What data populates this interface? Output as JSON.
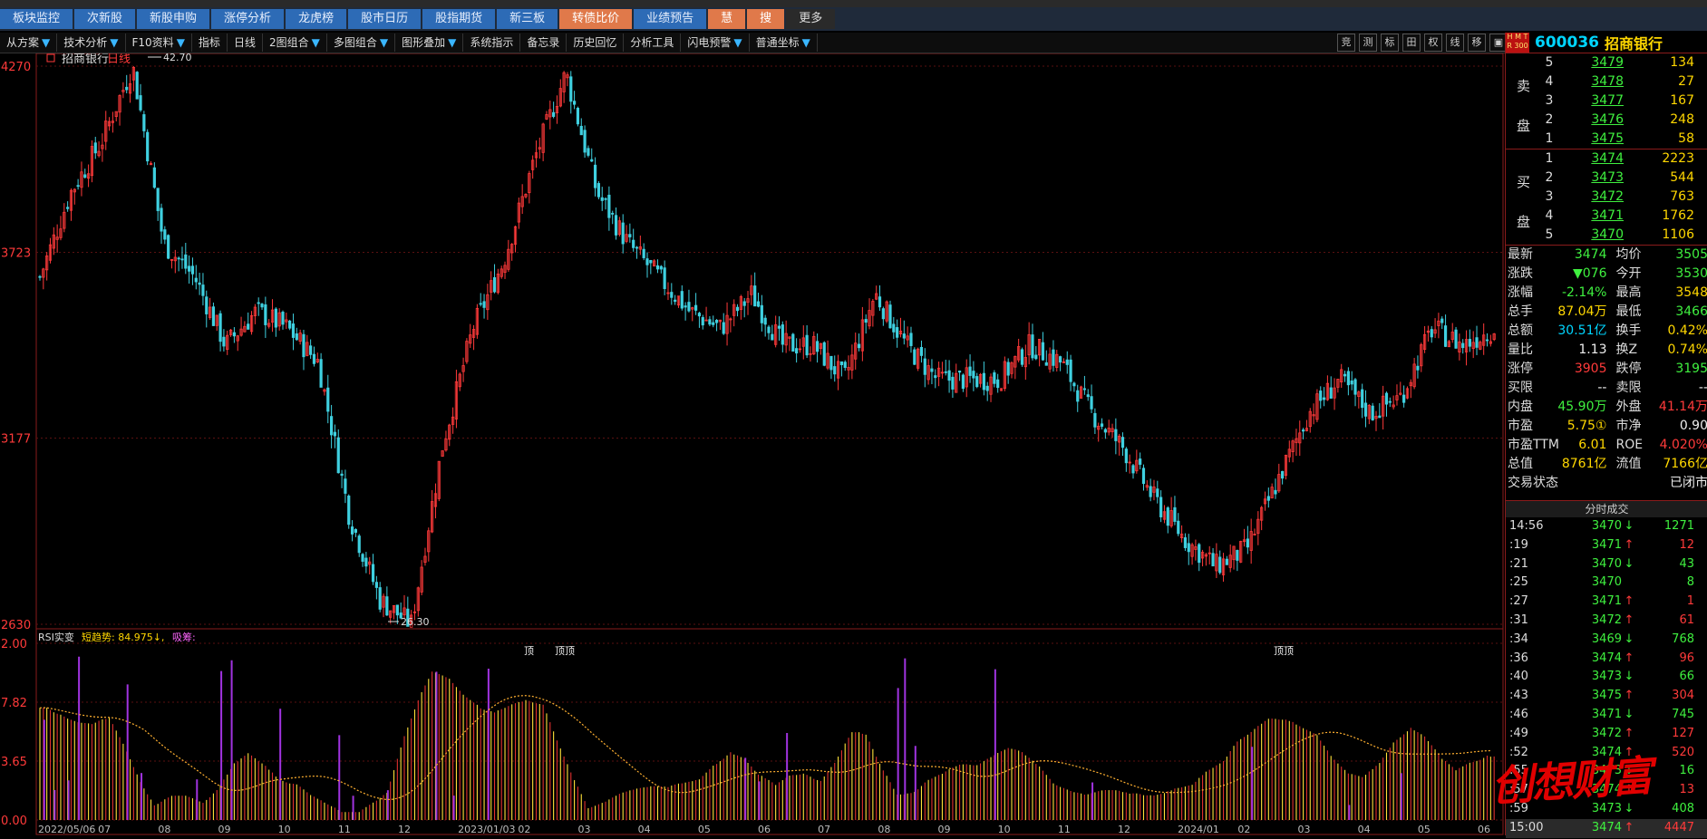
{
  "tabs": [
    "板块监控",
    "次新股",
    "新股申购",
    "涨停分析",
    "龙虎榜",
    "股市日历",
    "股指期货",
    "新三板",
    "转债比价",
    "业绩预告",
    "慧",
    "搜",
    "更多"
  ],
  "toolbar": [
    "技术分析",
    "F10资料",
    "指标",
    "日线",
    "2图组合",
    "多图组合",
    "图形叠加",
    "系统指示",
    "备忘录",
    "历史回忆",
    "分析工具",
    "闪电预警",
    "普通坐标"
  ],
  "toolbar_left": "从方案",
  "toolbar_right": [
    "竞",
    "测",
    "标",
    "田",
    "权",
    "线",
    "移",
    "▣",
    "▶"
  ],
  "chart": {
    "title": "招商银行",
    "period": "日线",
    "y_labels": [
      "4270",
      "3723",
      "3177",
      "2630"
    ],
    "high_label": "42.70",
    "low_label": "26.30",
    "ind_title": "RSI实变",
    "ind_trend": "短趋势: 84.975↓,",
    "ind_suck": "吸筹:",
    "ind_y_labels": [
      "2.00",
      "7.82",
      "3.65",
      "0.00"
    ],
    "top_markers": [
      "顶",
      "顶顶",
      "顶顶"
    ],
    "x_labels": [
      "2022/05/06",
      "07",
      "08",
      "09",
      "10",
      "11",
      "12",
      "2023/01/03",
      "02",
      "03",
      "04",
      "05",
      "06",
      "07",
      "08",
      "09",
      "10",
      "11",
      "12",
      "2024/01",
      "02",
      "03",
      "04",
      "05",
      "06"
    ]
  },
  "chart_data": {
    "type": "candlestick",
    "title": "招商银行 日线",
    "ylim": [
      2630,
      4270
    ],
    "y_ticks": [
      4270,
      3723,
      3177,
      2630
    ],
    "annotated_high": 42.7,
    "annotated_low": 26.3,
    "x_ticks": [
      "2022/05/06",
      "07",
      "08",
      "09",
      "10",
      "11",
      "12",
      "2023/01/03",
      "02",
      "03",
      "04",
      "05",
      "06",
      "07",
      "08",
      "09",
      "10",
      "11",
      "12",
      "2024/01",
      "02",
      "03",
      "04",
      "05",
      "06"
    ],
    "price_path": [
      3650,
      3900,
      4050,
      4270,
      3750,
      3650,
      3450,
      3550,
      3500,
      3400,
      2950,
      2700,
      2630,
      3150,
      3500,
      3700,
      4000,
      4250,
      3900,
      3750,
      3650,
      3550,
      3500,
      3600,
      3450,
      3450,
      3350,
      3600,
      3450,
      3350,
      3350,
      3350,
      3450,
      3400,
      3250,
      3150,
      3000,
      2880,
      2800,
      2850,
      3050,
      3250,
      3350,
      3250,
      3300,
      3500,
      3450,
      3500
    ]
  },
  "quote": {
    "hmt": "H M T R 300",
    "code": "600036",
    "name": "招商银行",
    "sell_label": [
      "卖",
      "盘"
    ],
    "buy_label": [
      "买",
      "盘"
    ],
    "sells": [
      {
        "lv": "5",
        "px": "3479",
        "vol": "134"
      },
      {
        "lv": "4",
        "px": "3478",
        "vol": "27"
      },
      {
        "lv": "3",
        "px": "3477",
        "vol": "167"
      },
      {
        "lv": "2",
        "px": "3476",
        "vol": "248"
      },
      {
        "lv": "1",
        "px": "3475",
        "vol": "58"
      }
    ],
    "buys": [
      {
        "lv": "1",
        "px": "3474",
        "vol": "2223"
      },
      {
        "lv": "2",
        "px": "3473",
        "vol": "544"
      },
      {
        "lv": "3",
        "px": "3472",
        "vol": "763"
      },
      {
        "lv": "4",
        "px": "3471",
        "vol": "1762"
      },
      {
        "lv": "5",
        "px": "3470",
        "vol": "1106"
      }
    ],
    "stats": [
      {
        "k": "最新",
        "v": "3474",
        "vc": "green",
        "k2": "均价",
        "v2": "3505",
        "v2c": "green"
      },
      {
        "k": "涨跌",
        "v": "▼076",
        "vc": "green",
        "k2": "今开",
        "v2": "3530",
        "v2c": "green"
      },
      {
        "k": "涨幅",
        "v": "-2.14%",
        "vc": "green",
        "k2": "最高",
        "v2": "3548",
        "v2c": "yellow"
      },
      {
        "k": "总手",
        "v": "87.04万",
        "vc": "yellow",
        "k2": "最低",
        "v2": "3466",
        "v2c": "green"
      },
      {
        "k": "总额",
        "v": "30.51亿",
        "vc": "cyan",
        "k2": "换手",
        "v2": "0.42%",
        "v2c": "yellow"
      },
      {
        "k": "量比",
        "v": "1.13",
        "vc": "white",
        "k2": "换Z",
        "v2": "0.74%",
        "v2c": "yellow"
      },
      {
        "k": "涨停",
        "v": "3905",
        "vc": "red",
        "k2": "跌停",
        "v2": "3195",
        "v2c": "green"
      },
      {
        "k": "买限",
        "v": "--",
        "vc": "white",
        "k2": "卖限",
        "v2": "--",
        "v2c": "white"
      },
      {
        "k": "内盘",
        "v": "45.90万",
        "vc": "green",
        "k2": "外盘",
        "v2": "41.14万",
        "v2c": "red"
      },
      {
        "k": "市盈",
        "v": "5.75①",
        "vc": "yellow",
        "k2": "市净",
        "v2": "0.90",
        "v2c": "white"
      },
      {
        "k": "市盈TTM",
        "v": "6.01",
        "vc": "yellow",
        "k2": "ROE",
        "v2": "4.020%",
        "v2c": "red"
      },
      {
        "k": "总值",
        "v": "8761亿",
        "vc": "yellow",
        "k2": "流值",
        "v2": "7166亿",
        "v2c": "yellow"
      },
      {
        "k": "交易状态",
        "v": "",
        "vc": "white",
        "k2": "",
        "v2": "已闭市",
        "v2c": "white"
      }
    ],
    "ticks_title": "分时成交",
    "ticks": [
      {
        "t": "14:56",
        "p": "3470",
        "a": "↓",
        "q": "1271",
        "pc": "green",
        "qc": "green"
      },
      {
        "t": ":19",
        "p": "3471",
        "a": "↑",
        "q": "12",
        "pc": "green",
        "qc": "red"
      },
      {
        "t": ":21",
        "p": "3470",
        "a": "↓",
        "q": "43",
        "pc": "green",
        "qc": "green"
      },
      {
        "t": ":25",
        "p": "3470",
        "a": "",
        "q": "8",
        "pc": "green",
        "qc": "green"
      },
      {
        "t": ":27",
        "p": "3471",
        "a": "↑",
        "q": "1",
        "pc": "green",
        "qc": "red"
      },
      {
        "t": ":31",
        "p": "3472",
        "a": "↑",
        "q": "61",
        "pc": "green",
        "qc": "red"
      },
      {
        "t": ":34",
        "p": "3469",
        "a": "↓",
        "q": "768",
        "pc": "green",
        "qc": "green"
      },
      {
        "t": ":36",
        "p": "3474",
        "a": "↑",
        "q": "96",
        "pc": "green",
        "qc": "red"
      },
      {
        "t": ":40",
        "p": "3473",
        "a": "↓",
        "q": "66",
        "pc": "green",
        "qc": "green"
      },
      {
        "t": ":43",
        "p": "3475",
        "a": "↑",
        "q": "304",
        "pc": "green",
        "qc": "red"
      },
      {
        "t": ":46",
        "p": "3471",
        "a": "↓",
        "q": "745",
        "pc": "green",
        "qc": "green"
      },
      {
        "t": ":49",
        "p": "3472",
        "a": "↑",
        "q": "127",
        "pc": "green",
        "qc": "red"
      },
      {
        "t": ":52",
        "p": "3474",
        "a": "↑",
        "q": "520",
        "pc": "green",
        "qc": "red"
      },
      {
        "t": ":55",
        "p": "3473",
        "a": "↓",
        "q": "16",
        "pc": "green",
        "qc": "green"
      },
      {
        "t": ":57",
        "p": "3474",
        "a": "↑",
        "q": "13",
        "pc": "green",
        "qc": "red"
      },
      {
        "t": ":59",
        "p": "3473",
        "a": "↓",
        "q": "408",
        "pc": "green",
        "qc": "green"
      },
      {
        "t": "15:00",
        "p": "3474",
        "a": "↑",
        "q": "4447",
        "pc": "green",
        "qc": "red"
      }
    ]
  },
  "watermark": "创想财富"
}
